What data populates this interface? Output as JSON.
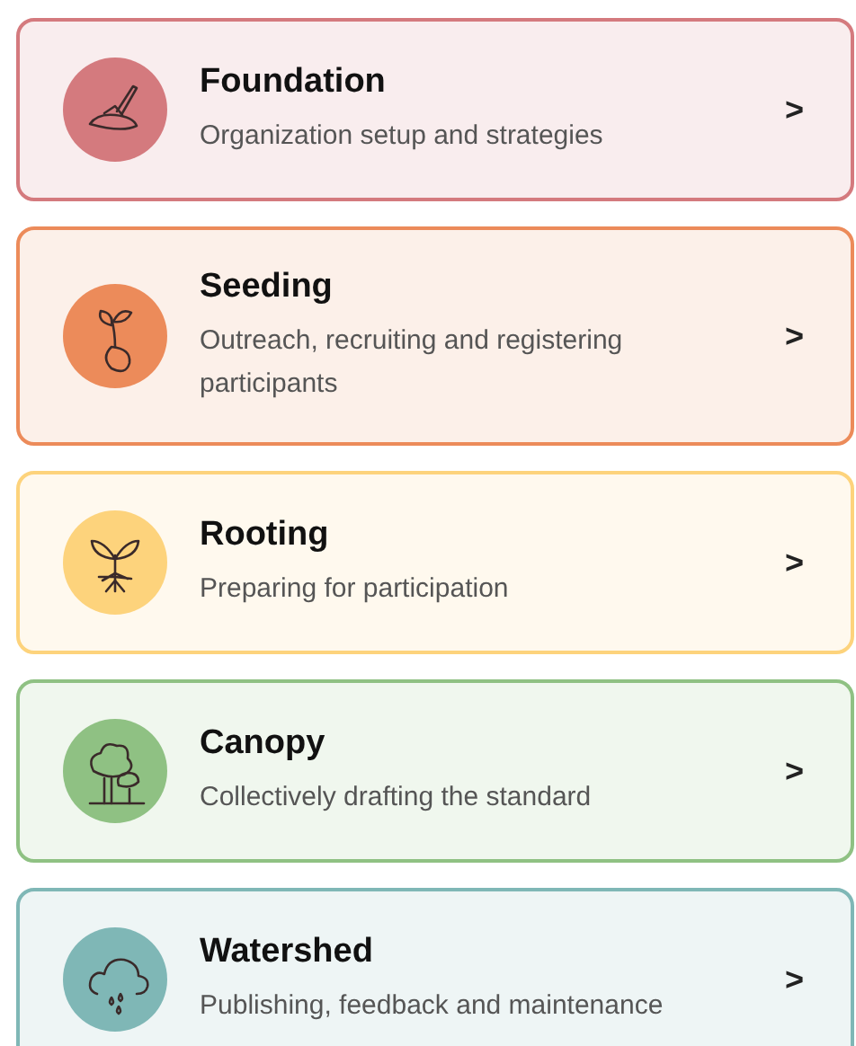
{
  "stages": [
    {
      "title": "Foundation",
      "subtitle": "Organization setup and strategies",
      "color": "#d47a7e",
      "kind": "trowel",
      "chevron": ">"
    },
    {
      "title": "Seeding",
      "subtitle": "Outreach, recruiting and registering participants",
      "color": "#ec8b5a",
      "kind": "seed",
      "chevron": ">"
    },
    {
      "title": "Rooting",
      "subtitle": "Preparing for participation",
      "color": "#fdd37c",
      "kind": "sprout",
      "chevron": ">"
    },
    {
      "title": "Canopy",
      "subtitle": "Collectively drafting the standard",
      "color": "#8fc183",
      "kind": "trees",
      "chevron": ">"
    },
    {
      "title": "Watershed",
      "subtitle": "Publishing, feedback and maintenance",
      "color": "#7fb7b6",
      "kind": "cloud",
      "chevron": ">"
    }
  ]
}
